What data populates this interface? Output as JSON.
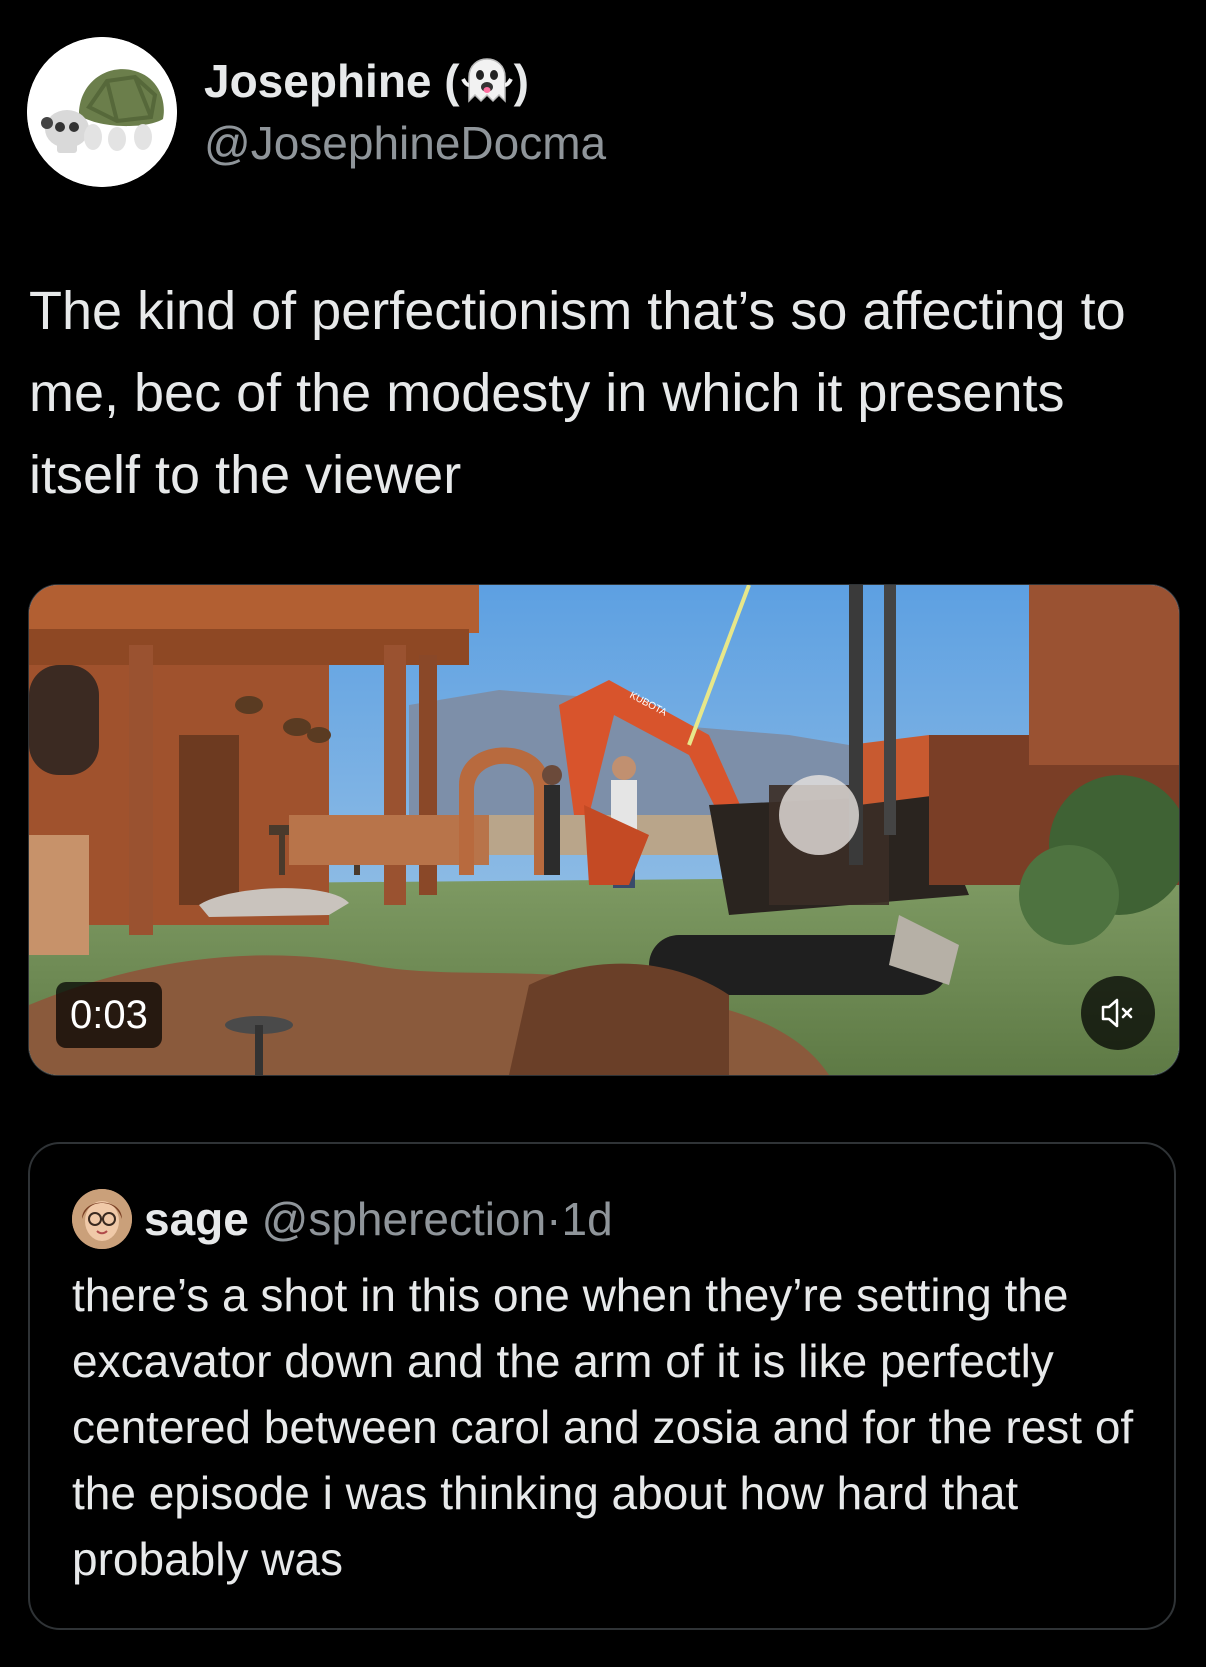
{
  "author": {
    "display_name_prefix": "Josephine (",
    "display_name_emoji": "ghost-emoji",
    "display_name_suffix": ")",
    "handle": "@JosephineDocma",
    "avatar_icon": "turtle-skull-icon"
  },
  "tweet": {
    "text": "The kind of perfectionism that’s so affecting to me, bec of the modesty in which it presents itself to the viewer"
  },
  "video": {
    "timestamp": "0:03",
    "mute_icon": "volume-muted-icon",
    "excavator_brand": "KUBOTA"
  },
  "quoted_tweet": {
    "name": "sage",
    "handle": "@spherection",
    "separator": "·",
    "time": "1d",
    "text": "there’s a shot in this one when they’re setting the excavator down and the arm of it is like perfectly centered between carol and zosia and for the rest of the episode i was thinking about how hard that probably was"
  },
  "colors": {
    "background": "#000000",
    "primary_text": "#e7e9ea",
    "secondary_text": "#8f959a",
    "border": "#2f3336"
  }
}
